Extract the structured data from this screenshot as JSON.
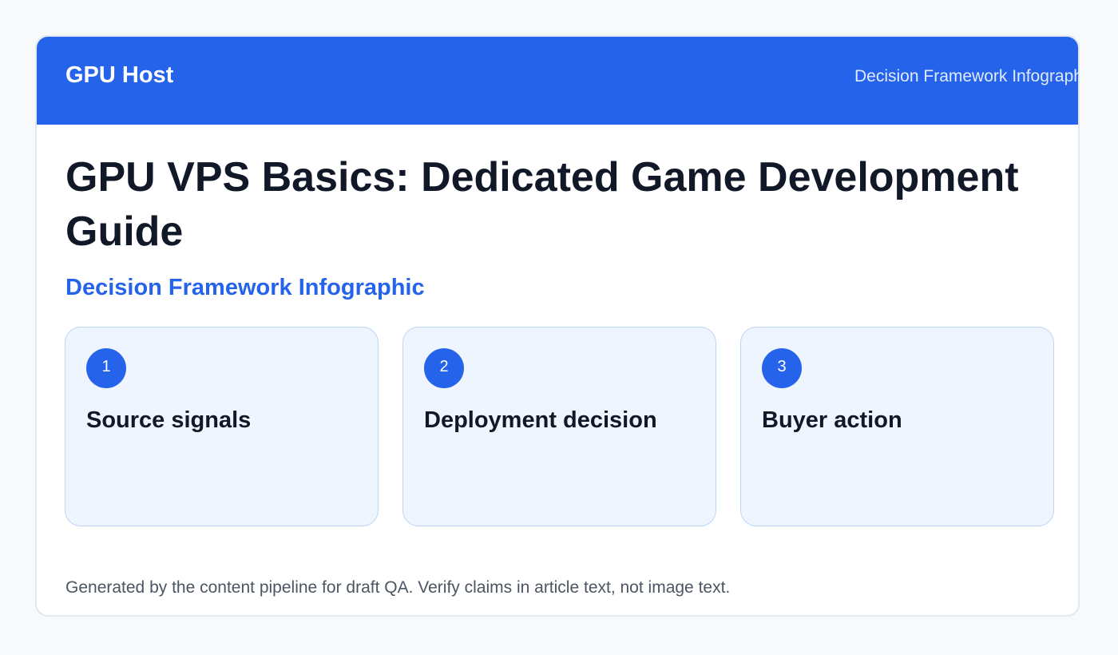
{
  "header": {
    "brand": "GPU Host",
    "subtitle": "Decision Framework Infographic"
  },
  "main": {
    "title": "GPU VPS Basics: Dedicated Game Development Guide",
    "section_title": "Decision Framework Infographic",
    "steps": [
      {
        "number": "1",
        "title": "Source signals"
      },
      {
        "number": "2",
        "title": "Deployment decision"
      },
      {
        "number": "3",
        "title": "Buyer action"
      }
    ]
  },
  "footer": {
    "note": "Generated by the content pipeline for draft QA. Verify claims in article text, not image text."
  },
  "colors": {
    "accent": "#2563eb",
    "card_bg": "#eef5ff",
    "heading": "#111827"
  }
}
